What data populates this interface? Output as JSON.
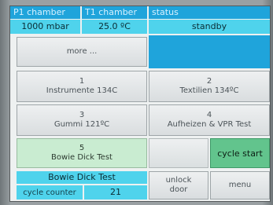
{
  "header": {
    "p1_label": "P1 chamber",
    "t1_label": "T1 chamber",
    "status_label": "status"
  },
  "values": {
    "p1": "1000 mbar",
    "t1": "25.0 ºC",
    "status": "standby"
  },
  "buttons": {
    "more": "more ...",
    "p1_num": "1",
    "p1_name": "Instrumente 134C",
    "p2_num": "2",
    "p2_name": "Textilien 134ºC",
    "p3_num": "3",
    "p3_name": "Gummi 121ºC",
    "p4_num": "4",
    "p4_name": "Aufheizen & VPR Test",
    "p5_num": "5",
    "p5_name": "Bowie Dick Test",
    "cycle_start": "cycle start",
    "unlock_line1": "unlock",
    "unlock_line2": "door",
    "menu": "menu"
  },
  "footer": {
    "program_name": "Bowie Dick Test",
    "counter_label": "cycle counter",
    "counter_value": "21"
  },
  "colors": {
    "header_blue": "#1fa4db",
    "value_cyan": "#4fd3ec",
    "program_green": "#62c48d",
    "program_green_pale": "#c9ecd1"
  }
}
